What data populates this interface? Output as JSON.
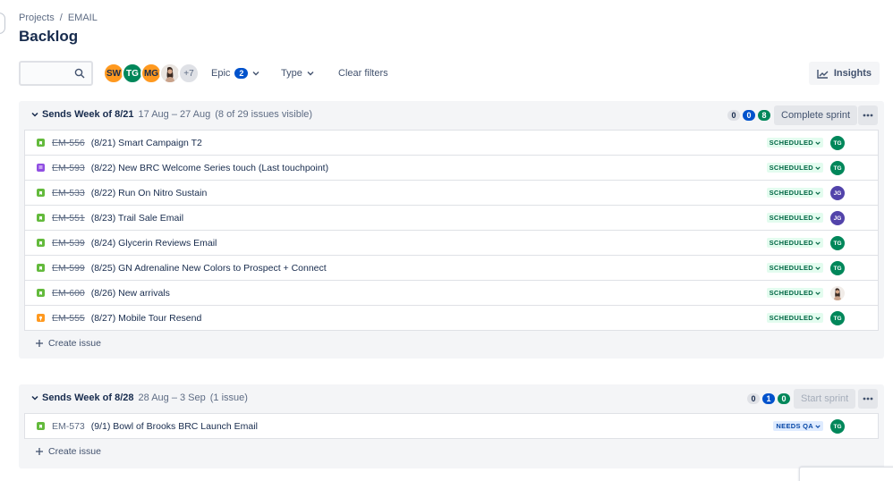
{
  "breadcrumb": {
    "projects": "Projects",
    "separator": "/",
    "project": "EMAIL"
  },
  "page_title": "Backlog",
  "toolbar": {
    "search_placeholder": "",
    "avatars": [
      "SW",
      "TG",
      "MG"
    ],
    "avatar_more": "+7",
    "epic_label": "Epic",
    "epic_count": "2",
    "type_label": "Type",
    "clear_filters": "Clear filters",
    "insights": "Insights"
  },
  "sprints": [
    {
      "name": "Sends Week of 8/21",
      "dates": "17 Aug – 27 Aug",
      "visibility": "(8 of 29 issues visible)",
      "counts": [
        "0",
        "0",
        "8"
      ],
      "action": "Complete sprint",
      "create_issue": "Create issue",
      "issues": [
        {
          "type": "story",
          "key": "EM-556",
          "summary": "(8/21) Smart Campaign T2",
          "status": "SCHEDULED",
          "assignee": "TG"
        },
        {
          "type": "epicish",
          "key": "EM-593",
          "summary": "(8/22) New BRC Welcome Series touch (Last touchpoint)",
          "status": "SCHEDULED",
          "assignee": "TG"
        },
        {
          "type": "story",
          "key": "EM-533",
          "summary": "(8/22) Run On Nitro Sustain",
          "status": "SCHEDULED",
          "assignee": "JG"
        },
        {
          "type": "story",
          "key": "EM-551",
          "summary": "(8/23) Trail Sale Email",
          "status": "SCHEDULED",
          "assignee": "JG"
        },
        {
          "type": "story",
          "key": "EM-539",
          "summary": "(8/24) Glycerin Reviews Email",
          "status": "SCHEDULED",
          "assignee": "TG"
        },
        {
          "type": "story",
          "key": "EM-599",
          "summary": "(8/25) GN Adrenaline New Colors to Prospect + Connect",
          "status": "SCHEDULED",
          "assignee": "TG"
        },
        {
          "type": "story",
          "key": "EM-600",
          "summary": "(8/26) New arrivals",
          "status": "SCHEDULED",
          "assignee": ""
        },
        {
          "type": "task",
          "key": "EM-555",
          "summary": "(8/27) Mobile Tour Resend",
          "status": "SCHEDULED",
          "assignee": "TG"
        }
      ]
    },
    {
      "name": "Sends Week of 8/28",
      "dates": "28 Aug – 3 Sep",
      "visibility": "(1 issue)",
      "counts": [
        "0",
        "1",
        "0"
      ],
      "action": "Start sprint",
      "create_issue": "Create issue",
      "issues": [
        {
          "type": "story",
          "key": "EM-573",
          "summary": "(9/1) Bowl of Brooks BRC Launch Email",
          "status": "NEEDS QA",
          "assignee": "TG"
        }
      ]
    }
  ],
  "colors": {
    "accent": "#0052cc",
    "done": "#00875a",
    "scheduled_bg": "#e3fcef",
    "qa_bg": "#deebff"
  }
}
